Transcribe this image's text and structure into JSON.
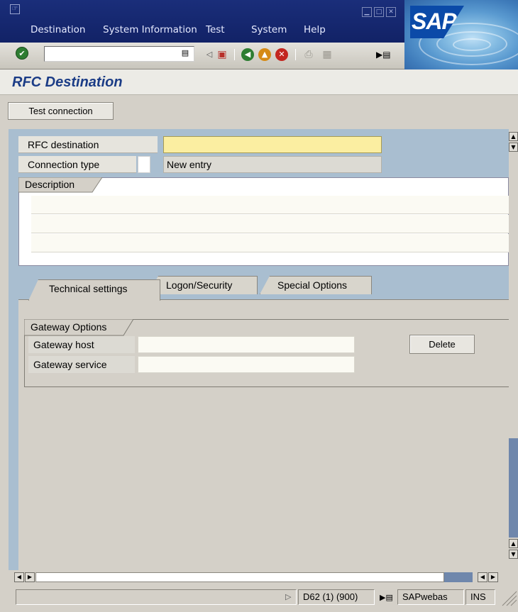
{
  "menu": {
    "items": [
      {
        "label": "Destination"
      },
      {
        "label": "System Information"
      },
      {
        "label": "Test"
      },
      {
        "label": "System"
      },
      {
        "label": "Help"
      }
    ]
  },
  "brand": {
    "logo_text": "SAP"
  },
  "toolbar": {
    "command_field_value": "",
    "icons": [
      "enter-check-icon",
      "command-dropdown-icon",
      "collapse-arrow-icon",
      "save-icon",
      "back-icon",
      "exit-icon",
      "cancel-icon",
      "print-icon",
      "find-icon",
      "layout-menu-icon"
    ]
  },
  "page": {
    "title": "RFC Destination"
  },
  "app_toolbar": {
    "test_connection_label": "Test connection"
  },
  "form": {
    "rfc_destination_label": "RFC destination",
    "rfc_destination_value": "",
    "connection_type_label": "Connection type",
    "connection_type_value": "",
    "connection_type_text": "New entry",
    "description_group_label": "Description",
    "description_lines": [
      "",
      "",
      ""
    ]
  },
  "tabs": [
    {
      "label": "Technical settings",
      "active": true
    },
    {
      "label": "Logon/Security",
      "active": false
    },
    {
      "label": "Special Options",
      "active": false
    }
  ],
  "gateway": {
    "group_label": "Gateway Options",
    "host_label": "Gateway host",
    "host_value": "",
    "service_label": "Gateway service",
    "service_value": "",
    "delete_label": "Delete"
  },
  "status": {
    "system_info": "D62 (1) (900)",
    "server": "SAPwebas",
    "mode": "INS"
  },
  "colors": {
    "title_bar": "#122266",
    "page_title": "#1b3c86",
    "work_area": "#a9bed0",
    "required_field": "#fbeea1",
    "scroll_thumb": "#6f87ac"
  }
}
